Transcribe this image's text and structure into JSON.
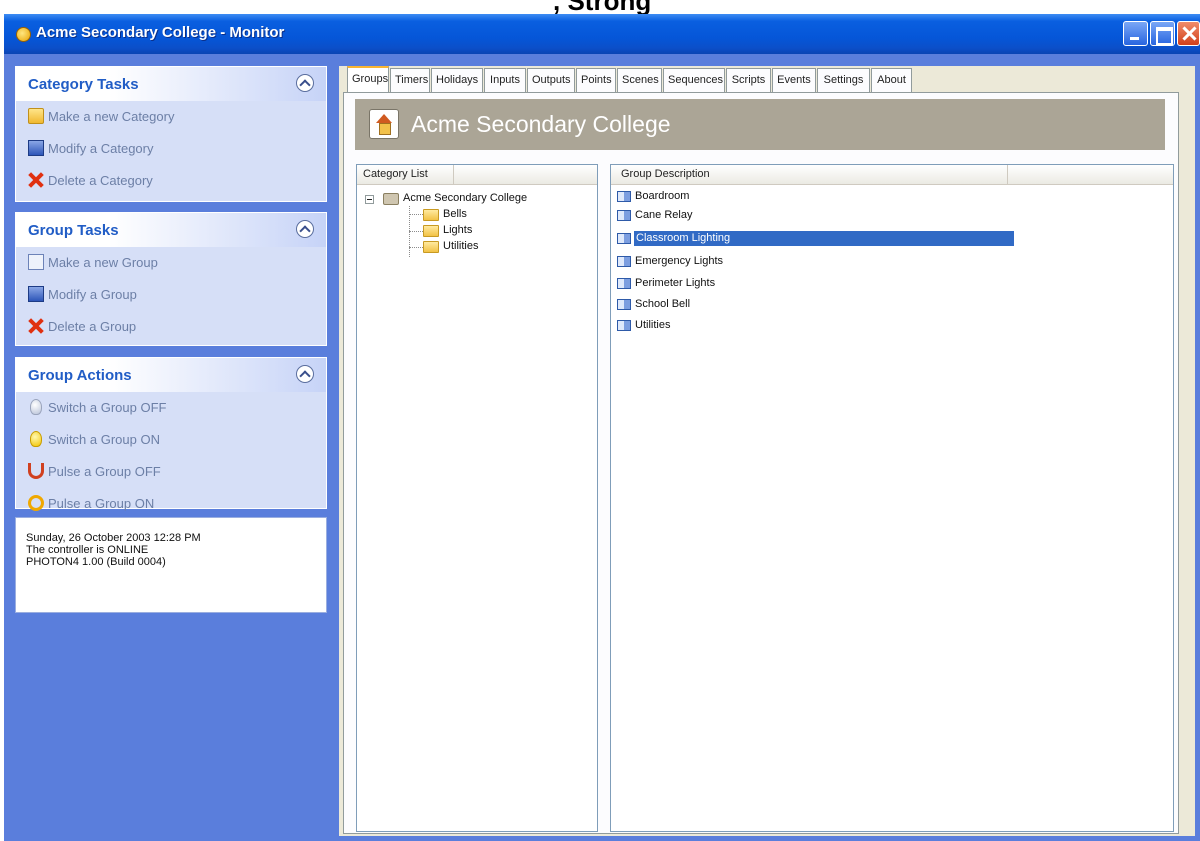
{
  "caption_fragment": ", Strong",
  "window": {
    "title": "Acme Secondary College - Monitor",
    "controls": [
      "minimize-icon",
      "maximize-icon",
      "close-icon"
    ]
  },
  "taskpane": {
    "sections": [
      {
        "title": "Category Tasks",
        "items": [
          {
            "label": "Make a new Category",
            "icon": "folder-new-icon"
          },
          {
            "label": "Modify a Category",
            "icon": "window-edit-icon"
          },
          {
            "label": "Delete a Category",
            "icon": "delete-x-icon"
          }
        ]
      },
      {
        "title": "Group Tasks",
        "items": [
          {
            "label": "Make a new Group",
            "icon": "group-new-icon"
          },
          {
            "label": "Modify a Group",
            "icon": "window-edit-icon"
          },
          {
            "label": "Delete a Group",
            "icon": "delete-x-icon"
          }
        ]
      },
      {
        "title": "Group Actions",
        "items": [
          {
            "label": "Switch a Group OFF",
            "icon": "bulb-off-icon"
          },
          {
            "label": "Switch a Group ON",
            "icon": "bulb-on-icon"
          },
          {
            "label": "Pulse a Group OFF",
            "icon": "pulse-off-icon"
          },
          {
            "label": "Pulse a Group ON",
            "icon": "pulse-on-icon"
          }
        ]
      }
    ],
    "status": {
      "line1": "Sunday, 26 October 2003 12:28 PM",
      "line2": "The controller is ONLINE",
      "line3": "PHOTON4 1.00 (Build 0004)"
    }
  },
  "tabs": [
    "Groups",
    "Timers",
    "Holidays",
    "Inputs",
    "Outputs",
    "Points",
    "Scenes",
    "Sequences",
    "Scripts",
    "Events",
    "Settings",
    "About"
  ],
  "active_tab": "Groups",
  "header": {
    "title": "Acme Secondary College"
  },
  "category_list": {
    "header": "Category List",
    "root": "Acme Secondary College",
    "children": [
      "Bells",
      "Lights",
      "Utilities"
    ]
  },
  "group_list": {
    "header": "Group Description",
    "rows": [
      "Boardroom",
      "Cane Relay",
      "Classroom Lighting",
      "Emergency Lights",
      "Perimeter Lights",
      "School Bell",
      "Utilities"
    ],
    "selected": "Classroom Lighting"
  },
  "colors": {
    "titlebar": "#0556d8",
    "pane_background": "#5a7edc",
    "pane_title": "#215dc6",
    "selection": "#316ac5",
    "header_band": "#aba596",
    "active_tab_accent": "#f9b532"
  }
}
